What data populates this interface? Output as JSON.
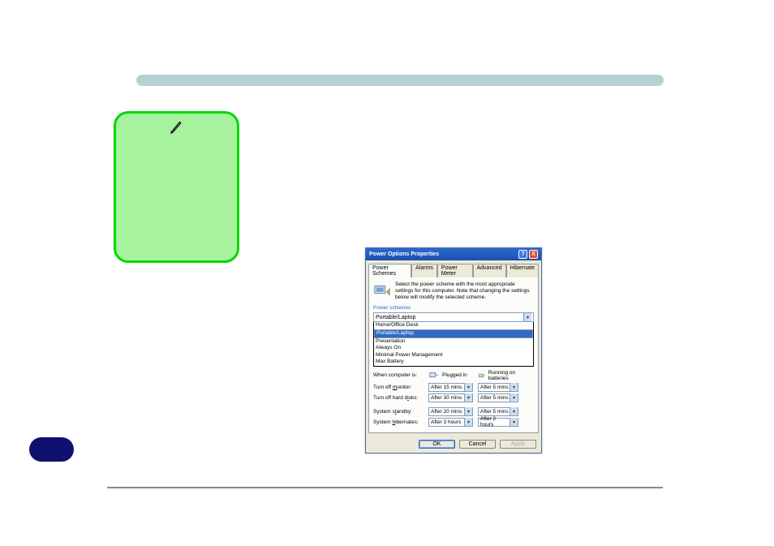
{
  "dialog": {
    "title": "Power Options Properties",
    "tabs": [
      "Power Schemes",
      "Alarms",
      "Power Meter",
      "Advanced",
      "Hibernate"
    ],
    "infoText": "Select the power scheme with the most appropriate settings for this computer. Note that changing the settings below will modify the selected scheme.",
    "groupLabel": "Power schemes",
    "selectedScheme": "Portable/Laptop",
    "schemeOptions": [
      "Home/Office Desk",
      "Portable/Laptop",
      "Presentation",
      "Always On",
      "Minimal Power Management",
      "Max Battery"
    ],
    "columns": {
      "rowLabel": "When computer is:",
      "pluggedIn": "Plugged in",
      "battery": "Running on batteries"
    },
    "settings": [
      {
        "label": "Turn off monitor:",
        "plugged": "After 15 mins",
        "battery": "After 5 mins"
      },
      {
        "label": "Turn off hard disks:",
        "plugged": "After 30 mins",
        "battery": "After 5 mins"
      },
      {
        "label": "System standby:",
        "plugged": "After 20 mins",
        "battery": "After 5 mins"
      },
      {
        "label": "System hibernates:",
        "plugged": "After 3 hours",
        "battery": "After 2 hours"
      }
    ],
    "buttons": {
      "ok": "OK",
      "cancel": "Cancel",
      "apply": "Apply"
    }
  }
}
